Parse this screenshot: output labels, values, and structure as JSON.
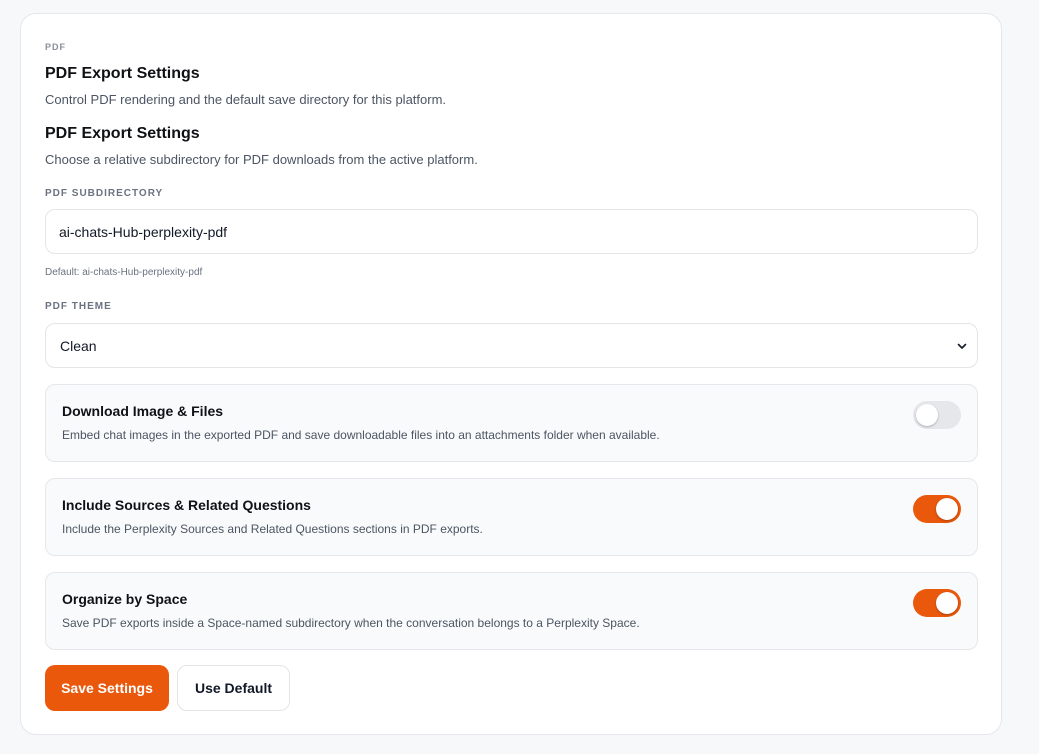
{
  "section_tag": "PDF",
  "header": {
    "title": "PDF Export Settings",
    "subtitle": "Control PDF rendering and the default save directory for this platform."
  },
  "subheader": {
    "title": "PDF Export Settings",
    "subtitle": "Choose a relative subdirectory for PDF downloads from the active platform."
  },
  "subdirectory": {
    "label": "PDF SUBDIRECTORY",
    "value": "ai-chats-Hub-perplexity-pdf",
    "hint": "Default: ai-chats-Hub-perplexity-pdf"
  },
  "theme": {
    "label": "PDF THEME",
    "selected": "Clean"
  },
  "toggles": [
    {
      "title": "Download Image & Files",
      "description": "Embed chat images in the exported PDF and save downloadable files into an attachments folder when available.",
      "enabled": false
    },
    {
      "title": "Include Sources & Related Questions",
      "description": "Include the Perplexity Sources and Related Questions sections in PDF exports.",
      "enabled": true
    },
    {
      "title": "Organize by Space",
      "description": "Save PDF exports inside a Space-named subdirectory when the conversation belongs to a Perplexity Space.",
      "enabled": true
    }
  ],
  "actions": {
    "save_label": "Save Settings",
    "default_label": "Use Default"
  },
  "colors": {
    "accent": "#ea580c",
    "toggle_off": "#e5e7eb"
  }
}
